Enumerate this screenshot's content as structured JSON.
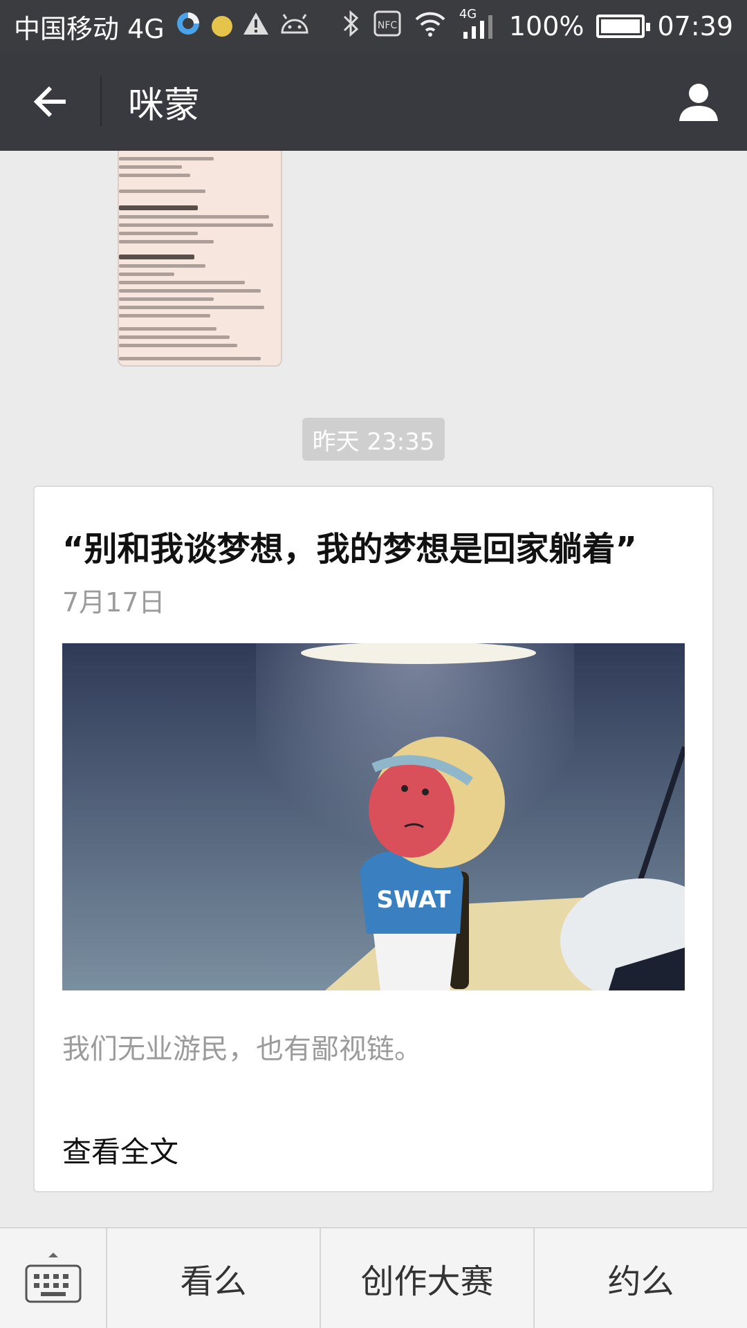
{
  "status_bar": {
    "carrier": "中国移动 4G",
    "network_label": "4G",
    "battery": "100%",
    "time": "07:39",
    "icons": [
      "browser-icon",
      "notification-dot-icon",
      "warning-icon",
      "android-icon",
      "bluetooth-icon",
      "nfc-icon",
      "wifi-icon",
      "signal-icon",
      "battery-icon"
    ]
  },
  "header": {
    "title": "咪蒙",
    "back_icon": "back-arrow-icon",
    "profile_icon": "profile-icon"
  },
  "chat": {
    "timestamp": "昨天 23:35",
    "article": {
      "title": "“别和我谈梦想，我的梦想是回家躺着”",
      "date": "7月17日",
      "digest": "我们无业游民，也有鄙视链。",
      "read_more": "查看全文"
    }
  },
  "bottom_menu": {
    "keyboard_icon": "keyboard-icon",
    "items": [
      "看么",
      "创作大赛",
      "约么"
    ]
  },
  "colors": {
    "header_bg": "#393a3f",
    "status_bg": "#3a3c3f",
    "chat_bg": "#ebebeb",
    "timestamp_bg": "#cfcfcf"
  }
}
